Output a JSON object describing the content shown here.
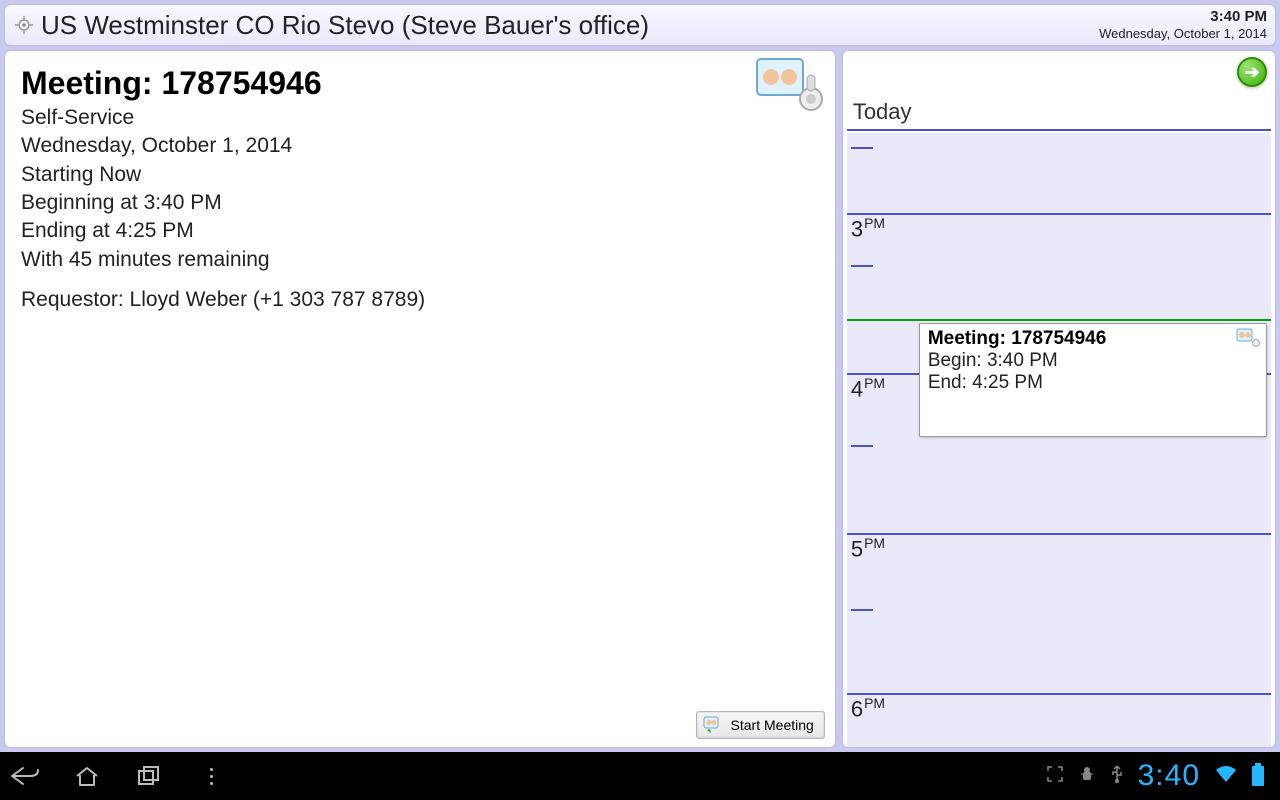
{
  "header": {
    "location_title": "US Westminster CO Rio Stevo (Steve Bauer's office)",
    "clock_time": "3:40 PM",
    "clock_date": "Wednesday, October 1, 2014"
  },
  "detail": {
    "title": "Meeting: 178754946",
    "type": "Self-Service",
    "date": "Wednesday, October 1, 2014",
    "status": "Starting Now",
    "begins": "Beginning at 3:40 PM",
    "ends": "Ending at 4:25 PM",
    "remaining": "With 45 minutes remaining",
    "requestor": "Requestor: Lloyd Weber (+1 303 787 8789)",
    "start_button": "Start Meeting"
  },
  "agenda": {
    "today_label": "Today",
    "hours": [
      "3",
      "4",
      "5",
      "6"
    ],
    "ampm": "PM",
    "event": {
      "title": "Meeting: 178754946",
      "begin": "Begin: 3:40 PM",
      "end": "End: 4:25 PM"
    }
  },
  "android": {
    "clock": "3:40"
  }
}
